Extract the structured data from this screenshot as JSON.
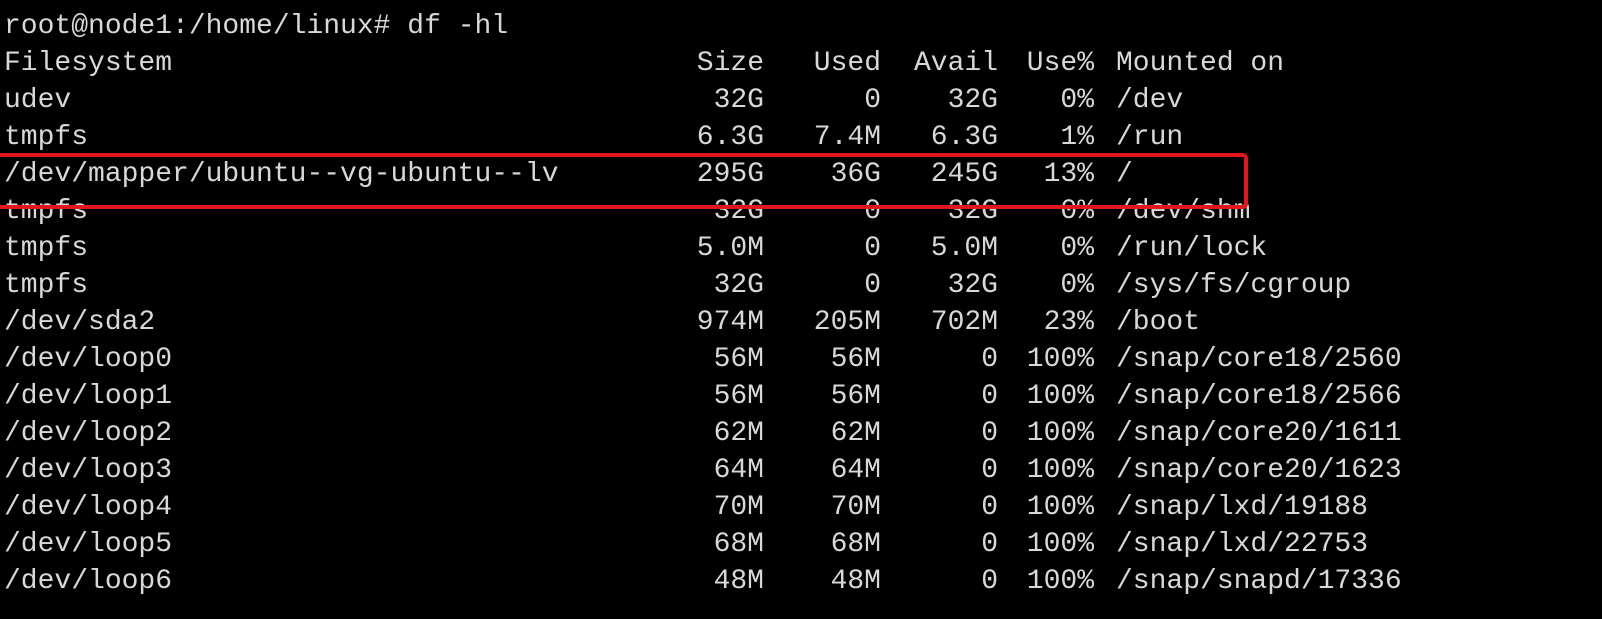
{
  "terminal": {
    "prompt": "root@node1:/home/linux#",
    "command": "df -hl",
    "columns": [
      "Filesystem",
      "Size",
      "Used",
      "Avail",
      "Use%",
      "Mounted on"
    ],
    "rows": [
      {
        "filesystem": "udev",
        "size": "32G",
        "used": "0",
        "avail": "32G",
        "use_pct": "0%",
        "mounted_on": "/dev"
      },
      {
        "filesystem": "tmpfs",
        "size": "6.3G",
        "used": "7.4M",
        "avail": "6.3G",
        "use_pct": "1%",
        "mounted_on": "/run"
      },
      {
        "filesystem": "/dev/mapper/ubuntu--vg-ubuntu--lv",
        "size": "295G",
        "used": "36G",
        "avail": "245G",
        "use_pct": "13%",
        "mounted_on": "/"
      },
      {
        "filesystem": "tmpfs",
        "size": "32G",
        "used": "0",
        "avail": "32G",
        "use_pct": "0%",
        "mounted_on": "/dev/shm"
      },
      {
        "filesystem": "tmpfs",
        "size": "5.0M",
        "used": "0",
        "avail": "5.0M",
        "use_pct": "0%",
        "mounted_on": "/run/lock"
      },
      {
        "filesystem": "tmpfs",
        "size": "32G",
        "used": "0",
        "avail": "32G",
        "use_pct": "0%",
        "mounted_on": "/sys/fs/cgroup"
      },
      {
        "filesystem": "/dev/sda2",
        "size": "974M",
        "used": "205M",
        "avail": "702M",
        "use_pct": "23%",
        "mounted_on": "/boot"
      },
      {
        "filesystem": "/dev/loop0",
        "size": "56M",
        "used": "56M",
        "avail": "0",
        "use_pct": "100%",
        "mounted_on": "/snap/core18/2560"
      },
      {
        "filesystem": "/dev/loop1",
        "size": "56M",
        "used": "56M",
        "avail": "0",
        "use_pct": "100%",
        "mounted_on": "/snap/core18/2566"
      },
      {
        "filesystem": "/dev/loop2",
        "size": "62M",
        "used": "62M",
        "avail": "0",
        "use_pct": "100%",
        "mounted_on": "/snap/core20/1611"
      },
      {
        "filesystem": "/dev/loop3",
        "size": "64M",
        "used": "64M",
        "avail": "0",
        "use_pct": "100%",
        "mounted_on": "/snap/core20/1623"
      },
      {
        "filesystem": "/dev/loop4",
        "size": "70M",
        "used": "70M",
        "avail": "0",
        "use_pct": "100%",
        "mounted_on": "/snap/lxd/19188"
      },
      {
        "filesystem": "/dev/loop5",
        "size": "68M",
        "used": "68M",
        "avail": "0",
        "use_pct": "100%",
        "mounted_on": "/snap/lxd/22753"
      },
      {
        "filesystem": "/dev/loop6",
        "size": "48M",
        "used": "48M",
        "avail": "0",
        "use_pct": "100%",
        "mounted_on": "/snap/snapd/17336"
      }
    ]
  },
  "colors": {
    "background": "#000000",
    "text": "#d8d8d8",
    "highlight": "#e3161b"
  }
}
